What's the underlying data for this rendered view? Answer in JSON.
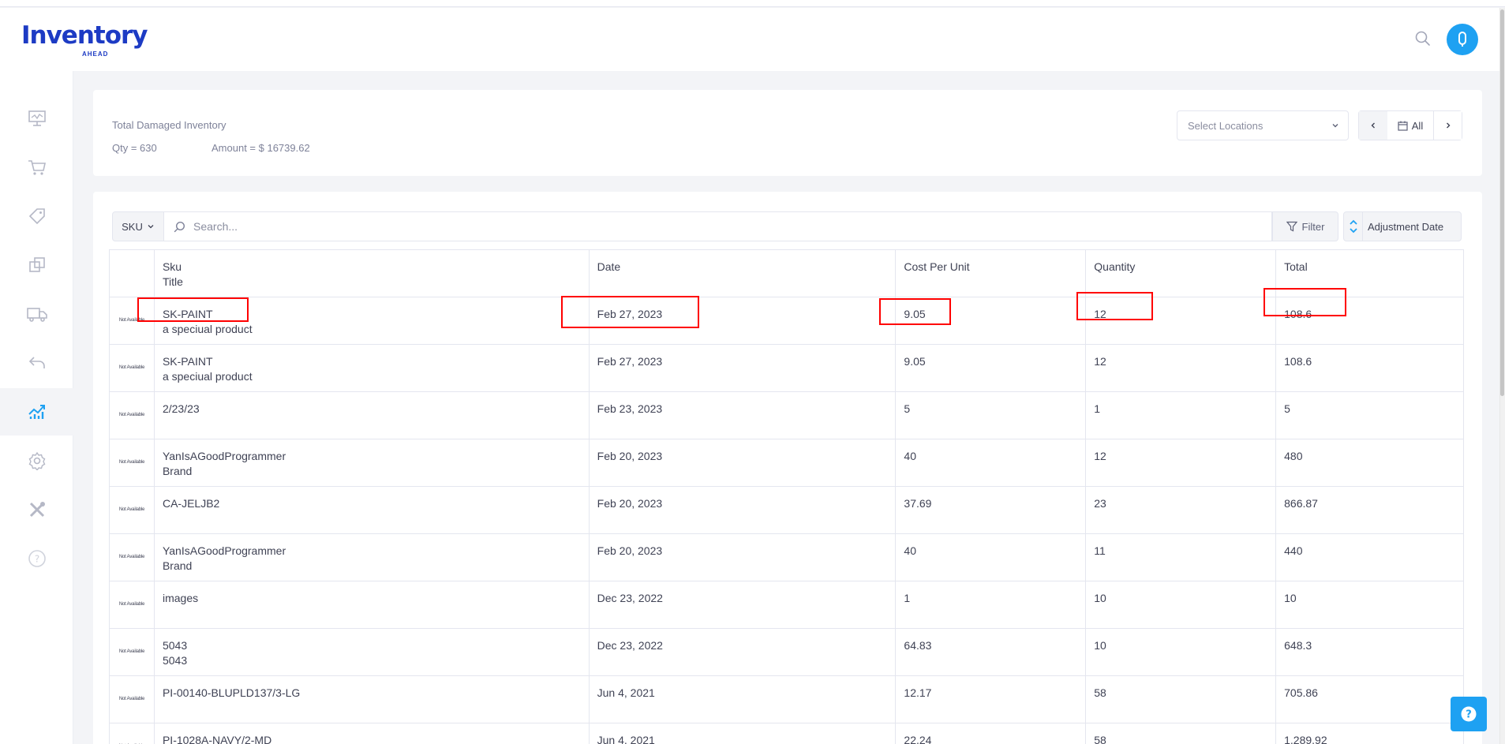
{
  "brand": {
    "name": "Inventory",
    "tagline": "AHEAD"
  },
  "header": {
    "search_icon": "search-icon",
    "avatar_icon": "user-icon"
  },
  "sidebar": {
    "items": [
      {
        "icon": "dashboard-icon",
        "active": false
      },
      {
        "icon": "cart-icon",
        "active": false
      },
      {
        "icon": "tag-icon",
        "active": false
      },
      {
        "icon": "layers-icon",
        "active": false
      },
      {
        "icon": "truck-icon",
        "active": false
      },
      {
        "icon": "return-icon",
        "active": false
      },
      {
        "icon": "reports-icon",
        "active": true
      },
      {
        "icon": "settings-icon",
        "active": false
      },
      {
        "icon": "tools-icon",
        "active": false
      },
      {
        "icon": "help-icon",
        "active": false
      }
    ]
  },
  "summary": {
    "title": "Total Damaged Inventory",
    "qty": "Qty = 630",
    "amount": "Amount = $ 16739.62",
    "location_placeholder": "Select Locations",
    "period": "All"
  },
  "toolbar": {
    "search_field": "SKU",
    "search_placeholder": "Search...",
    "filter_label": "Filter",
    "sort_label": "Adjustment Date"
  },
  "table": {
    "headers": {
      "sku": "Sku",
      "title": "Title",
      "date": "Date",
      "cost": "Cost Per Unit",
      "qty": "Quantity",
      "total": "Total"
    },
    "image_placeholder": "Not Available",
    "rows": [
      {
        "sku": "SK-PAINT",
        "title": "a speciual product",
        "date": "Feb 27, 2023",
        "cost": "9.05",
        "qty": "12",
        "total": "108.6"
      },
      {
        "sku": "SK-PAINT",
        "title": "a speciual product",
        "date": "Feb 27, 2023",
        "cost": "9.05",
        "qty": "12",
        "total": "108.6"
      },
      {
        "sku": "2/23/23",
        "title": "",
        "date": "Feb 23, 2023",
        "cost": "5",
        "qty": "1",
        "total": "5"
      },
      {
        "sku": "YanIsAGoodProgrammer",
        "title": "Brand",
        "date": "Feb 20, 2023",
        "cost": "40",
        "qty": "12",
        "total": "480"
      },
      {
        "sku": "CA-JELJB2",
        "title": "",
        "date": "Feb 20, 2023",
        "cost": "37.69",
        "qty": "23",
        "total": "866.87"
      },
      {
        "sku": "YanIsAGoodProgrammer",
        "title": "Brand",
        "date": "Feb 20, 2023",
        "cost": "40",
        "qty": "11",
        "total": "440"
      },
      {
        "sku": "images",
        "title": "",
        "date": "Dec 23, 2022",
        "cost": "1",
        "qty": "10",
        "total": "10"
      },
      {
        "sku": "5043",
        "title": "5043",
        "date": "Dec 23, 2022",
        "cost": "64.83",
        "qty": "10",
        "total": "648.3"
      },
      {
        "sku": "PI-00140-BLUPLD137/3-LG",
        "title": "",
        "date": "Jun 4, 2021",
        "cost": "12.17",
        "qty": "58",
        "total": "705.86"
      },
      {
        "sku": "PI-1028A-NAVY/2-MD",
        "title": "",
        "date": "Jun 4, 2021",
        "cost": "22.24",
        "qty": "58",
        "total": "1,289.92"
      }
    ]
  },
  "highlight_color": "#ff0000",
  "accent_color": "#1ea1f2"
}
